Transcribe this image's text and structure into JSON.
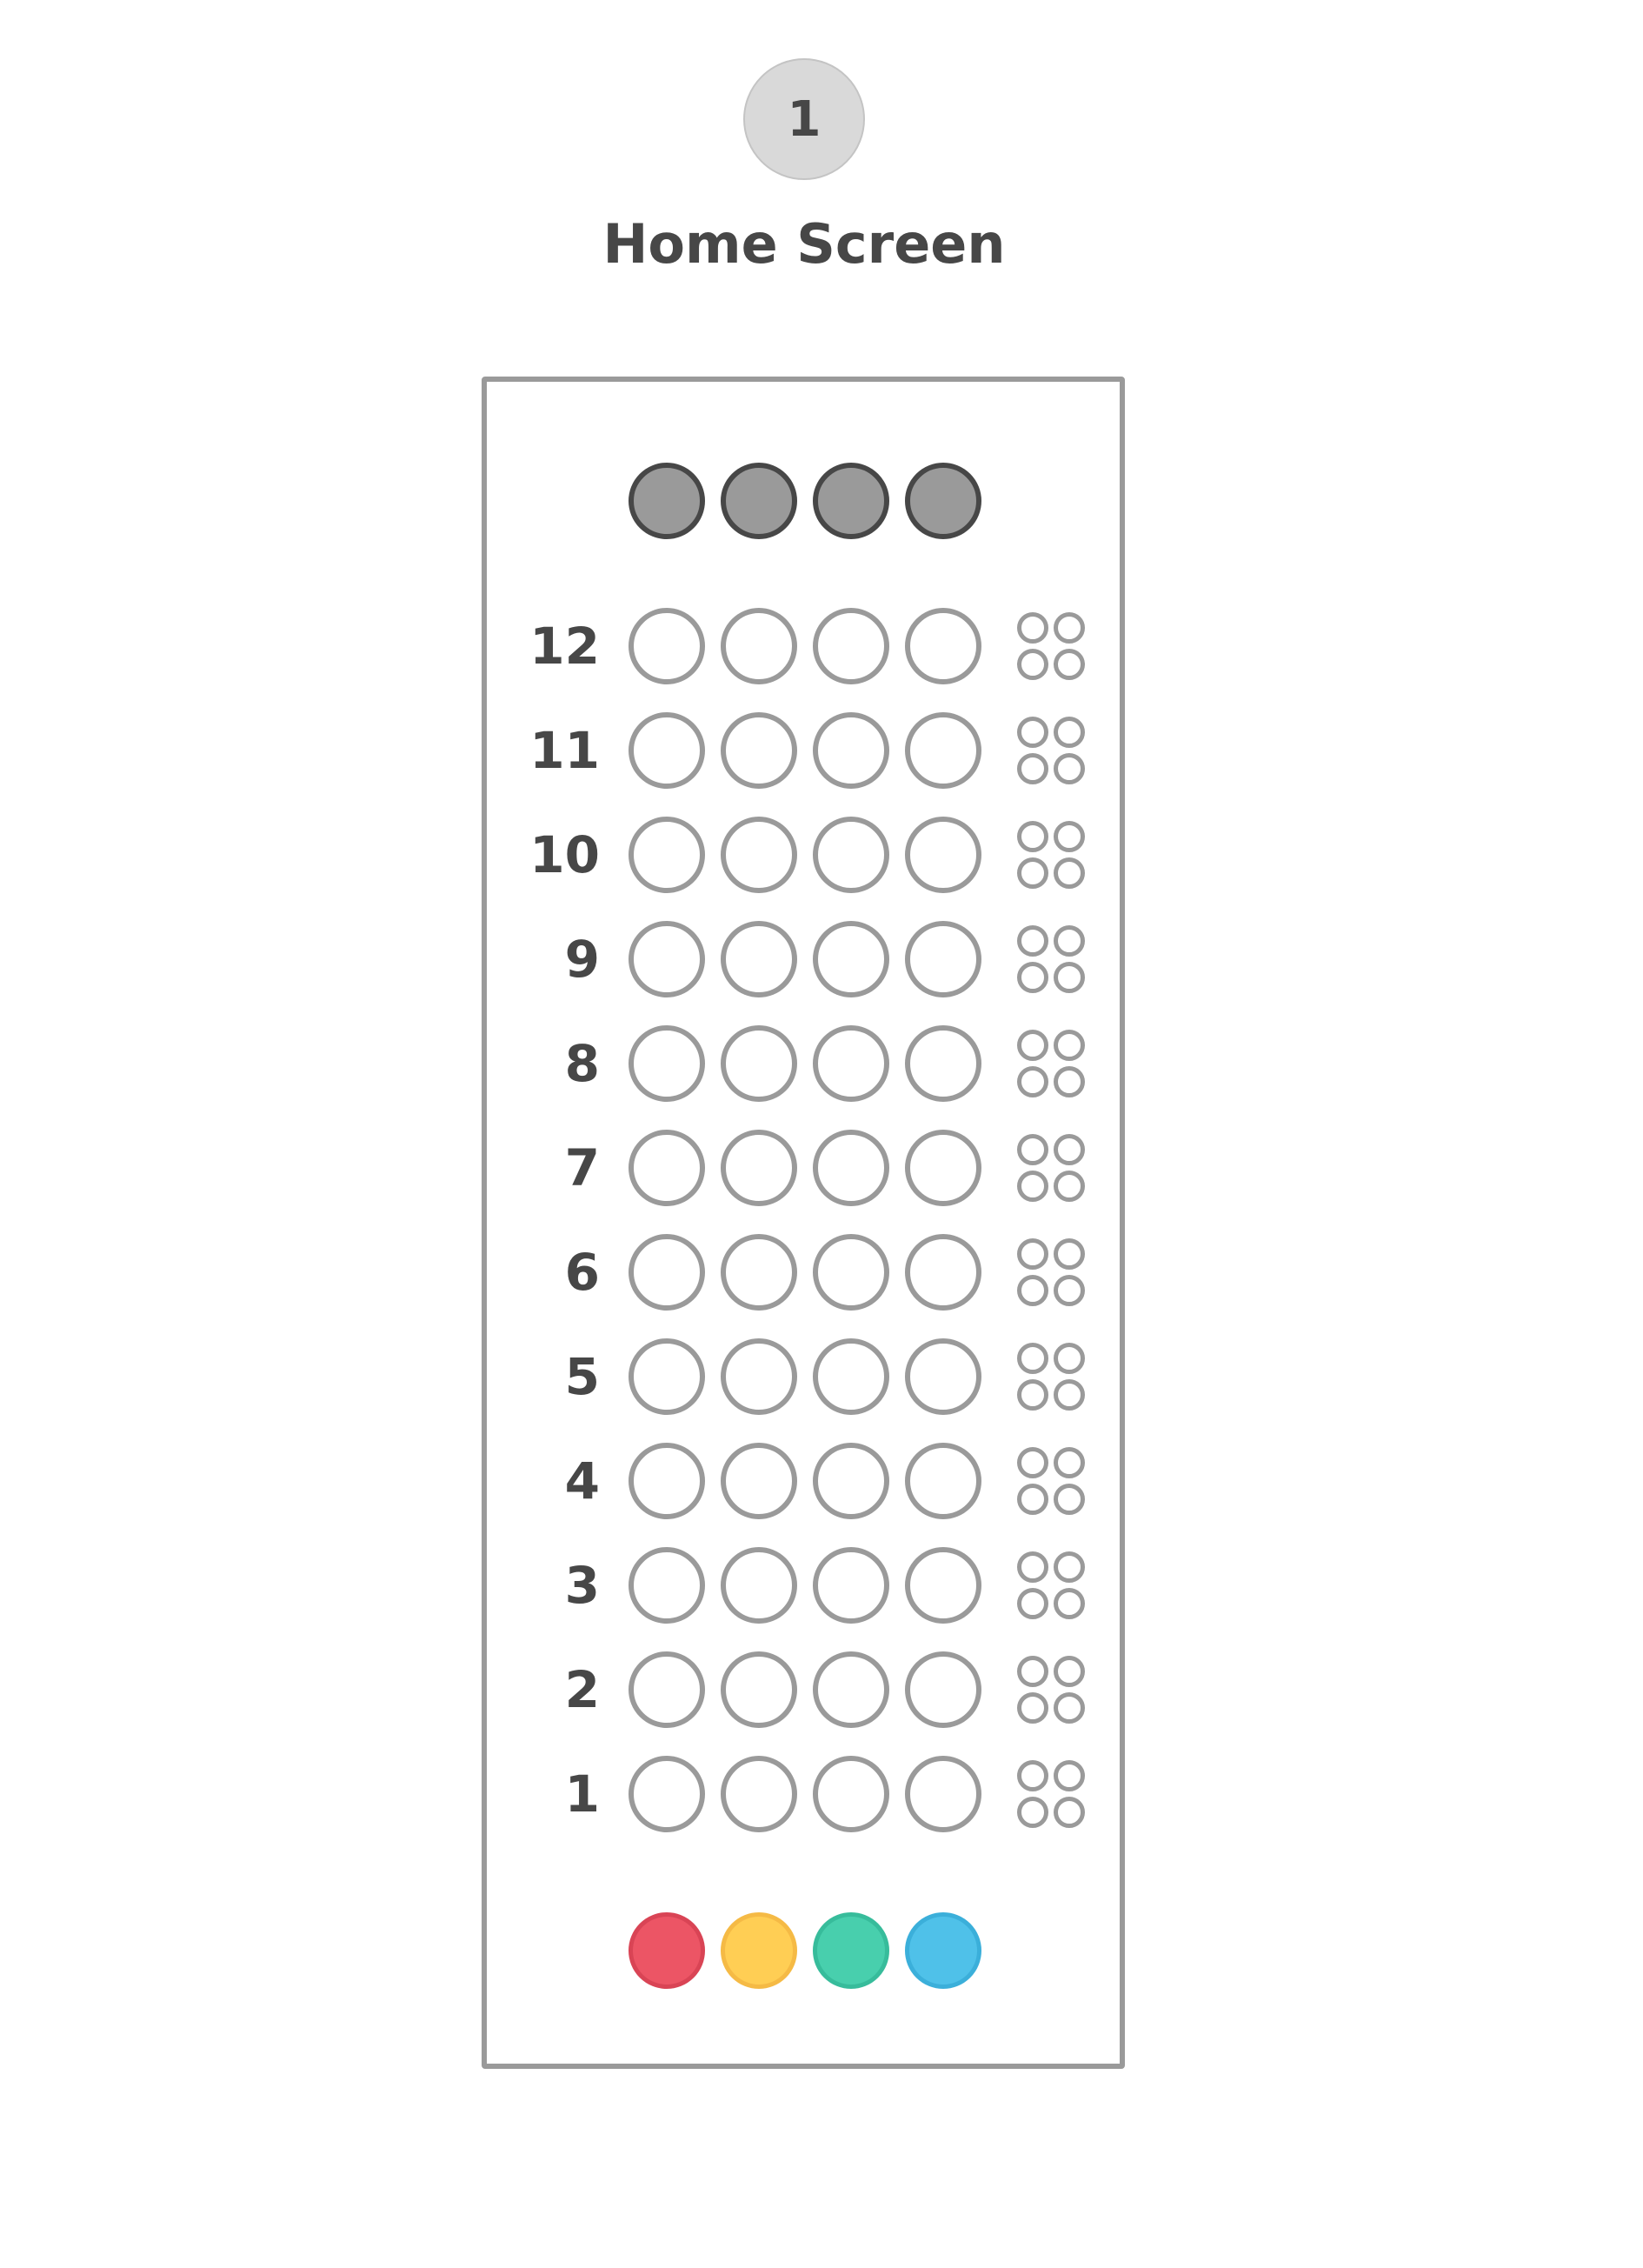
{
  "header": {
    "step_number": "1",
    "title": "Home Screen"
  },
  "board": {
    "secret_pegs": 4,
    "secret_color": "#9a9a9a",
    "rows": [
      {
        "number": "12"
      },
      {
        "number": "11"
      },
      {
        "number": "10"
      },
      {
        "number": "9"
      },
      {
        "number": "8"
      },
      {
        "number": "7"
      },
      {
        "number": "6"
      },
      {
        "number": "5"
      },
      {
        "number": "4"
      },
      {
        "number": "3"
      },
      {
        "number": "2"
      },
      {
        "number": "1"
      }
    ],
    "palette": [
      {
        "name": "red",
        "fill": "#ec5565",
        "stroke": "#d94455"
      },
      {
        "name": "yellow",
        "fill": "#ffce54",
        "stroke": "#f5ba45"
      },
      {
        "name": "green",
        "fill": "#48cfad",
        "stroke": "#37bc9b"
      },
      {
        "name": "blue",
        "fill": "#4fc1e9",
        "stroke": "#3bafda"
      }
    ]
  }
}
